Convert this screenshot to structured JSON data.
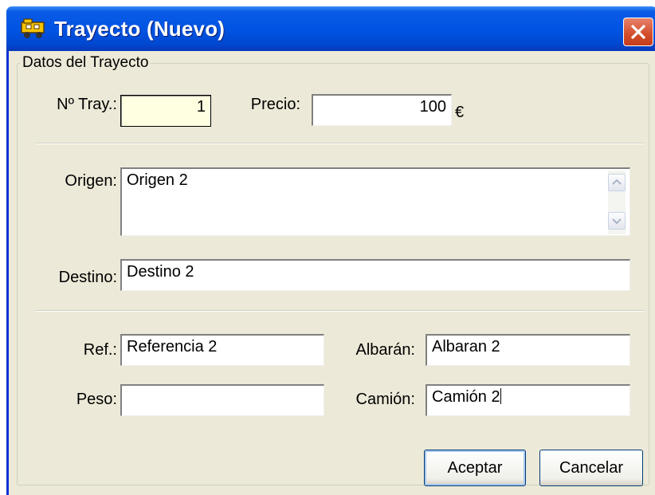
{
  "window": {
    "title": "Trayecto (Nuevo)",
    "icon": "vehicle-icon"
  },
  "group": {
    "legend": "Datos del Trayecto"
  },
  "fields": {
    "num_tray": {
      "label": "Nº Tray.:",
      "value": "1"
    },
    "precio": {
      "label": "Precio:",
      "value": "100",
      "unit": "€"
    },
    "origen": {
      "label": "Origen:",
      "value": "Origen 2"
    },
    "destino": {
      "label": "Destino:",
      "value": "Destino 2"
    },
    "ref": {
      "label": "Ref.:",
      "value": "Referencia 2"
    },
    "albaran": {
      "label": "Albarán:",
      "value": "Albaran 2"
    },
    "peso": {
      "label": "Peso:",
      "value": ""
    },
    "camion": {
      "label": "Camión:",
      "value": "Camión 2"
    }
  },
  "buttons": {
    "accept": "Aceptar",
    "cancel": "Cancelar"
  },
  "colors": {
    "titlebar": "#0054e3",
    "close": "#d24d2a",
    "face": "#ece9d8",
    "highlight_field": "#ffffe1"
  }
}
